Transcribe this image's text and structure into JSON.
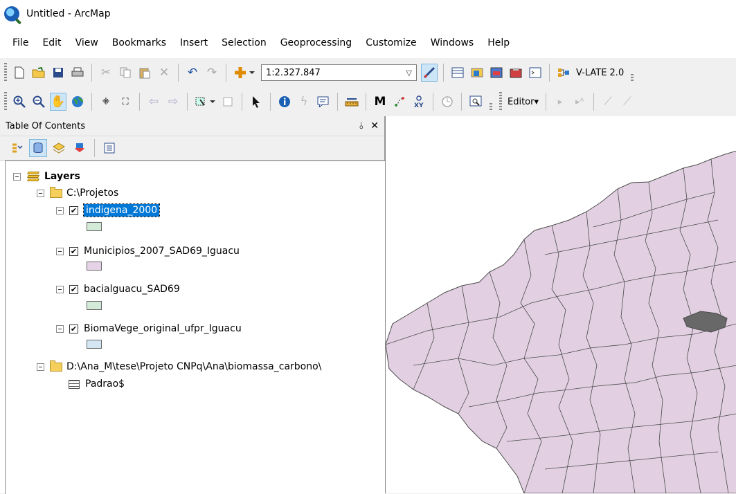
{
  "window": {
    "title": "Untitled - ArcMap"
  },
  "menu": [
    "File",
    "Edit",
    "View",
    "Bookmarks",
    "Insert",
    "Selection",
    "Geoprocessing",
    "Customize",
    "Windows",
    "Help"
  ],
  "toolbar": {
    "scale": "1:2.327.847",
    "vlate_label": "V-LATE 2.0",
    "editor_label": "Editor▾"
  },
  "toc": {
    "title": "Table Of Contents",
    "root": "Layers",
    "folder1": "C:\\Projetos",
    "layers": [
      {
        "name": "indigena_2000",
        "checked": true,
        "swatch": "#d4ead8",
        "selected": true
      },
      {
        "name": "Municipios_2007_SAD69_Iguacu",
        "checked": true,
        "swatch": "#e6d2e6"
      },
      {
        "name": "bacialguacu_SAD69",
        "checked": true,
        "swatch": "#d4ead8"
      },
      {
        "name": "BiomaVege_original_ufpr_Iguacu",
        "checked": true,
        "swatch": "#d4e6f2"
      }
    ],
    "folder2": "D:\\Ana_M\\tese\\Projeto CNPq\\Ana\\biomassa_carbono\\",
    "table": "Padrao$"
  },
  "colors": {
    "map_fill": "#e2d0e2",
    "map_border": "#4a4a4a",
    "indigenous_fill": "#686868",
    "selection": "#0078d7"
  }
}
